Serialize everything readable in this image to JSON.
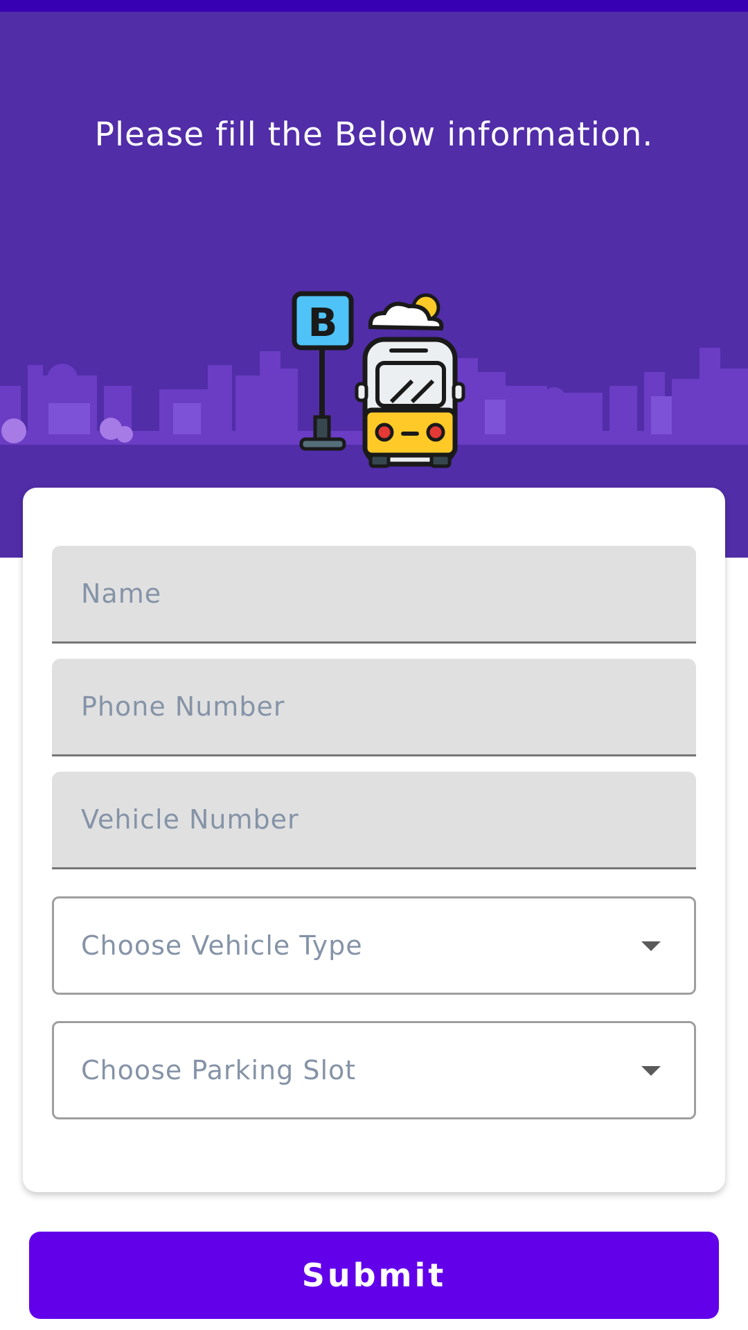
{
  "header": {
    "title": "Please fill the Below information.",
    "illustration_icon": "bus-stop-icon",
    "illustration_sign_letter": "B"
  },
  "form": {
    "name_placeholder": "Name",
    "phone_placeholder": "Phone Number",
    "vehicle_number_placeholder": "Vehicle Number",
    "vehicle_type_label": "Choose Vehicle Type",
    "parking_slot_label": "Choose Parking Slot",
    "dropdown_icon": "chevron-down-icon"
  },
  "actions": {
    "submit_label": "Submit"
  },
  "colors": {
    "status_bar": "#3700b3",
    "header_bg": "#512da8",
    "primary": "#6200ea",
    "field_fill": "#e0e0e0",
    "placeholder": "#8593a7"
  }
}
